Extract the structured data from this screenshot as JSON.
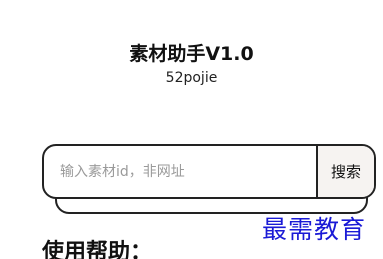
{
  "header": {
    "title": "素材助手V1.0",
    "subtitle": "52pojie"
  },
  "search": {
    "placeholder": "输入素材id，非网址",
    "value": "",
    "button_label": "搜索"
  },
  "help": {
    "heading": "使用帮助："
  },
  "watermark": {
    "text": "最需教育"
  },
  "colors": {
    "watermark": "#1a1ad6",
    "button_bg": "#f6f3f1",
    "border": "#222222"
  }
}
